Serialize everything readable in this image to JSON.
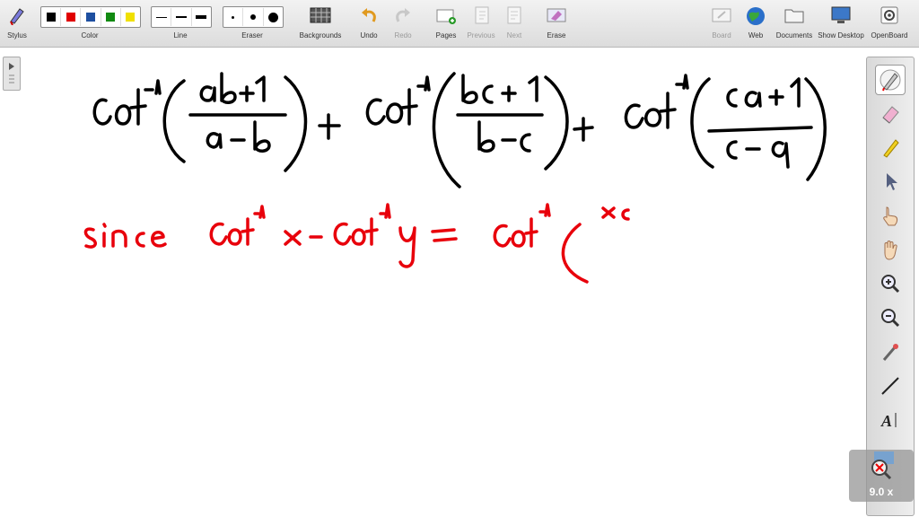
{
  "toolbar": {
    "stylus": "Stylus",
    "color": "Color",
    "line": "Line",
    "eraser": "Eraser",
    "backgrounds": "Backgrounds",
    "undo": "Undo",
    "redo": "Redo",
    "pages": "Pages",
    "previous": "Previous",
    "next": "Next",
    "erase": "Erase",
    "board": "Board",
    "web": "Web",
    "documents": "Documents",
    "show_desktop": "Show Desktop",
    "openboard": "OpenBoard"
  },
  "colors": {
    "swatches": [
      "#000000",
      "#e00000",
      "#1e4fa0",
      "#128a12",
      "#f0e000"
    ],
    "ink_black": "#000000",
    "ink_red": "#e8000b"
  },
  "stylus_palette": {
    "tools": [
      "pen-icon",
      "eraser-icon",
      "highlighter-icon",
      "pointer-icon",
      "hand-pointer-icon",
      "hand-grab-icon",
      "zoom-in-icon",
      "zoom-out-icon",
      "laser-icon",
      "line-icon",
      "text-icon"
    ]
  },
  "zoom": {
    "level": "9.0 x"
  },
  "board": {
    "handwritten_line1": "cot⁻¹((ab+1)/(a−b)) + cot⁻¹((bc+1)/(b−c)) + cot⁻¹((ca+1)/(c−a))",
    "handwritten_line2": "since cot⁻¹x − cot⁻¹y = cot⁻¹( x"
  }
}
